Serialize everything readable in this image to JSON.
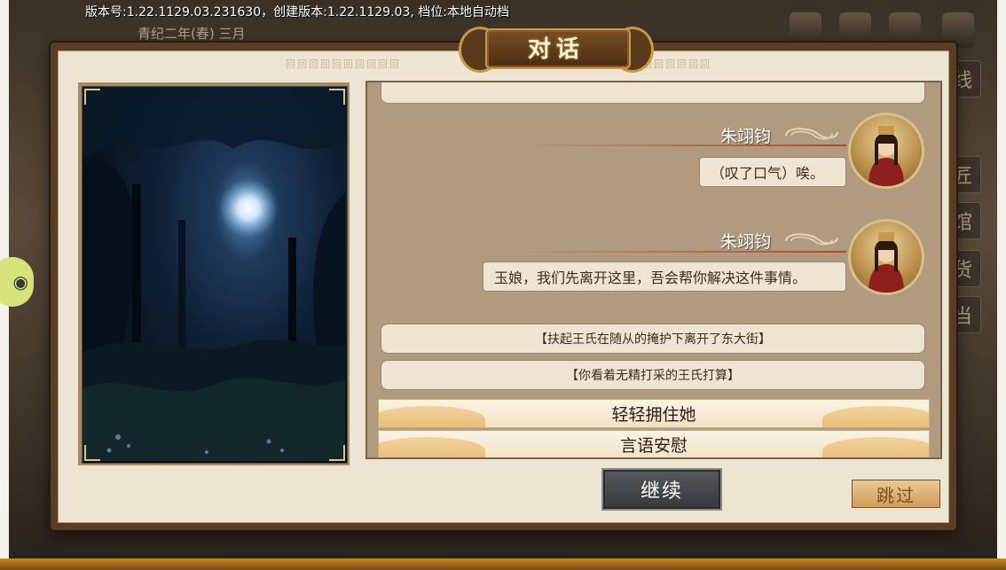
{
  "version_text": "版本号:1.22.1129.03.231630，创建版本:1.22.1129.03, 档位:本地自动档",
  "game_date": "青纪二年(春) 三月",
  "dialog": {
    "title": "对话",
    "narration_top": "",
    "lines": [
      {
        "speaker": "朱翊钧",
        "text": "（叹了口气）唉。"
      },
      {
        "speaker": "朱翊钧",
        "text": "玉娘，我们先离开这里，吾会帮你解决这件事情。"
      }
    ],
    "narrations": [
      "【扶起王氏在随从的掩护下离开了东大街】",
      "【你看着无精打采的王氏打算】"
    ],
    "choices": [
      "轻轻拥住她",
      "言语安慰"
    ],
    "continue_label": "继续",
    "skip_label": "跳过"
  },
  "side_tabs": [
    "线",
    "匠",
    "馆",
    "货",
    "当"
  ],
  "colors": {
    "frame": "#5a3d24",
    "parchment": "#ede4d1",
    "panel": "#b09b80",
    "accent": "#c8974a"
  }
}
